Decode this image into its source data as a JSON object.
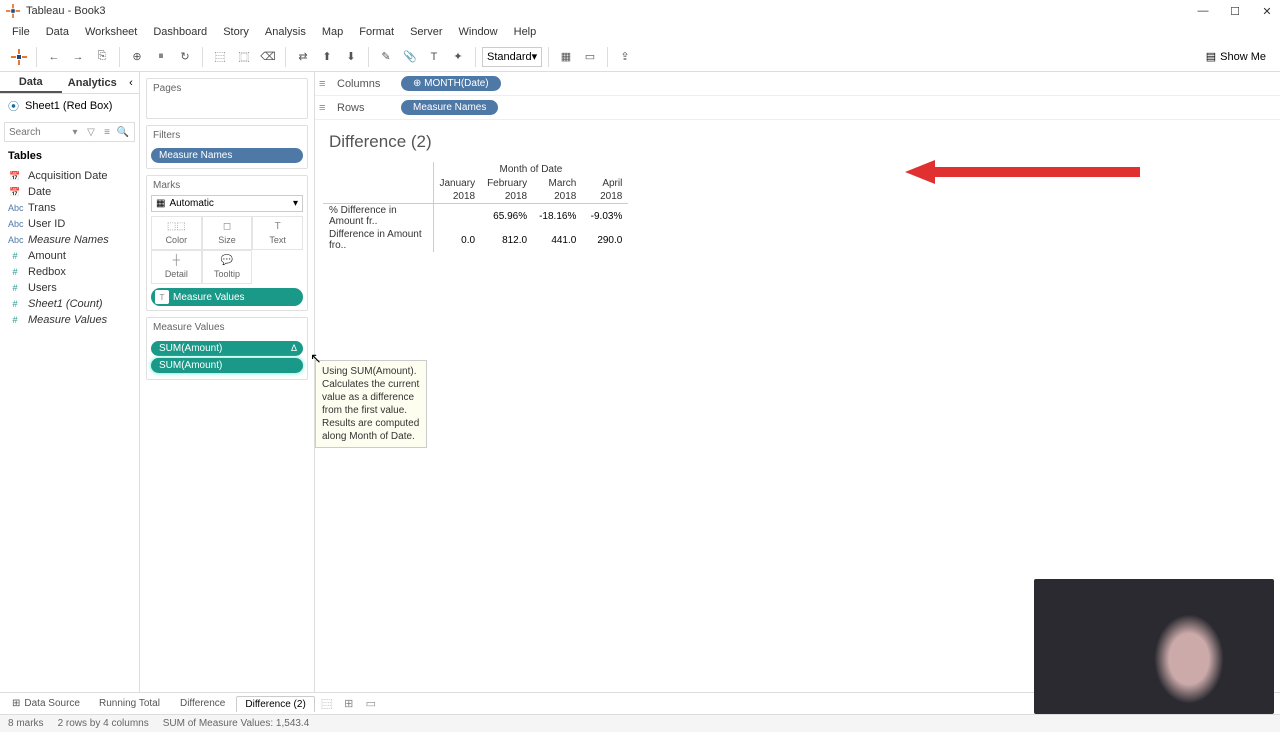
{
  "window": {
    "title": "Tableau - Book3"
  },
  "menu": [
    "File",
    "Data",
    "Worksheet",
    "Dashboard",
    "Story",
    "Analysis",
    "Map",
    "Format",
    "Server",
    "Window",
    "Help"
  ],
  "toolbar": {
    "fit": "Standard",
    "showme": "Show Me"
  },
  "datapanel": {
    "tabs": {
      "data": "Data",
      "analytics": "Analytics"
    },
    "datasource": "Sheet1 (Red Box)",
    "search_placeholder": "Search",
    "tables_hdr": "Tables",
    "fields": [
      {
        "icon": "📅",
        "cls": "dim",
        "name": "Acquisition Date"
      },
      {
        "icon": "📅",
        "cls": "dim",
        "name": "Date"
      },
      {
        "icon": "Abc",
        "cls": "dim",
        "name": "Trans"
      },
      {
        "icon": "Abc",
        "cls": "dim",
        "name": "User ID"
      },
      {
        "icon": "Abc",
        "cls": "dim",
        "name": "Measure Names",
        "italic": true
      },
      {
        "icon": "#",
        "cls": "meas",
        "name": "Amount"
      },
      {
        "icon": "#",
        "cls": "meas",
        "name": "Redbox"
      },
      {
        "icon": "#",
        "cls": "meas",
        "name": "Users"
      },
      {
        "icon": "#",
        "cls": "meas",
        "name": "Sheet1 (Count)",
        "italic": true
      },
      {
        "icon": "#",
        "cls": "meas",
        "name": "Measure Values",
        "italic": true
      }
    ]
  },
  "shelves": {
    "pages": "Pages",
    "filters": "Filters",
    "filters_pill": "Measure Names",
    "marks": "Marks",
    "marks_type": "Automatic",
    "marks_cells": [
      {
        "icon": "⬚⬚",
        "label": "Color"
      },
      {
        "icon": "◻",
        "label": "Size"
      },
      {
        "icon": "T",
        "label": "Text"
      },
      {
        "icon": "┼",
        "label": "Detail"
      },
      {
        "icon": "💬",
        "label": "Tooltip"
      }
    ],
    "marks_text_pill": "Measure Values",
    "mvalues_hdr": "Measure Values",
    "mvalues": [
      {
        "label": "SUM(Amount)",
        "delta": "Δ"
      },
      {
        "label": "SUM(Amount)",
        "delta": ""
      }
    ]
  },
  "colrow": {
    "columns_label": "Columns",
    "columns_pill": "MONTH(Date)",
    "rows_label": "Rows",
    "rows_pill": "Measure Names"
  },
  "sheet": {
    "title": "Difference (2)",
    "col_super": "Month of Date",
    "cols": [
      {
        "m": "January",
        "y": "2018"
      },
      {
        "m": "February",
        "y": "2018"
      },
      {
        "m": "March",
        "y": "2018"
      },
      {
        "m": "April",
        "y": "2018"
      }
    ],
    "rows": [
      {
        "hdr": "% Difference in Amount fr..",
        "vals": [
          "",
          "65.96%",
          "-18.16%",
          "-9.03%"
        ]
      },
      {
        "hdr": "Difference in Amount fro..",
        "vals": [
          "0.0",
          "812.0",
          "441.0",
          "290.0"
        ]
      }
    ]
  },
  "tooltip": "Using SUM(Amount). Calculates the current value as a difference from the first value.  Results are computed along Month of Date.",
  "tabs": {
    "datasource": "Data Source",
    "sheets": [
      "Running Total",
      "Difference",
      "Difference (2)"
    ]
  },
  "status": {
    "marks": "8 marks",
    "dims": "2 rows by 4 columns",
    "sum": "SUM of Measure Values: 1,543.4"
  },
  "chart_data": {
    "type": "table",
    "title": "Difference (2)",
    "column_super_header": "Month of Date",
    "columns": [
      "January 2018",
      "February 2018",
      "March 2018",
      "April 2018"
    ],
    "series": [
      {
        "name": "% Difference in Amount from the First",
        "values": [
          null,
          65.96,
          -18.16,
          -9.03
        ],
        "unit": "%"
      },
      {
        "name": "Difference in Amount from the First",
        "values": [
          0.0,
          812.0,
          441.0,
          290.0
        ]
      }
    ]
  }
}
